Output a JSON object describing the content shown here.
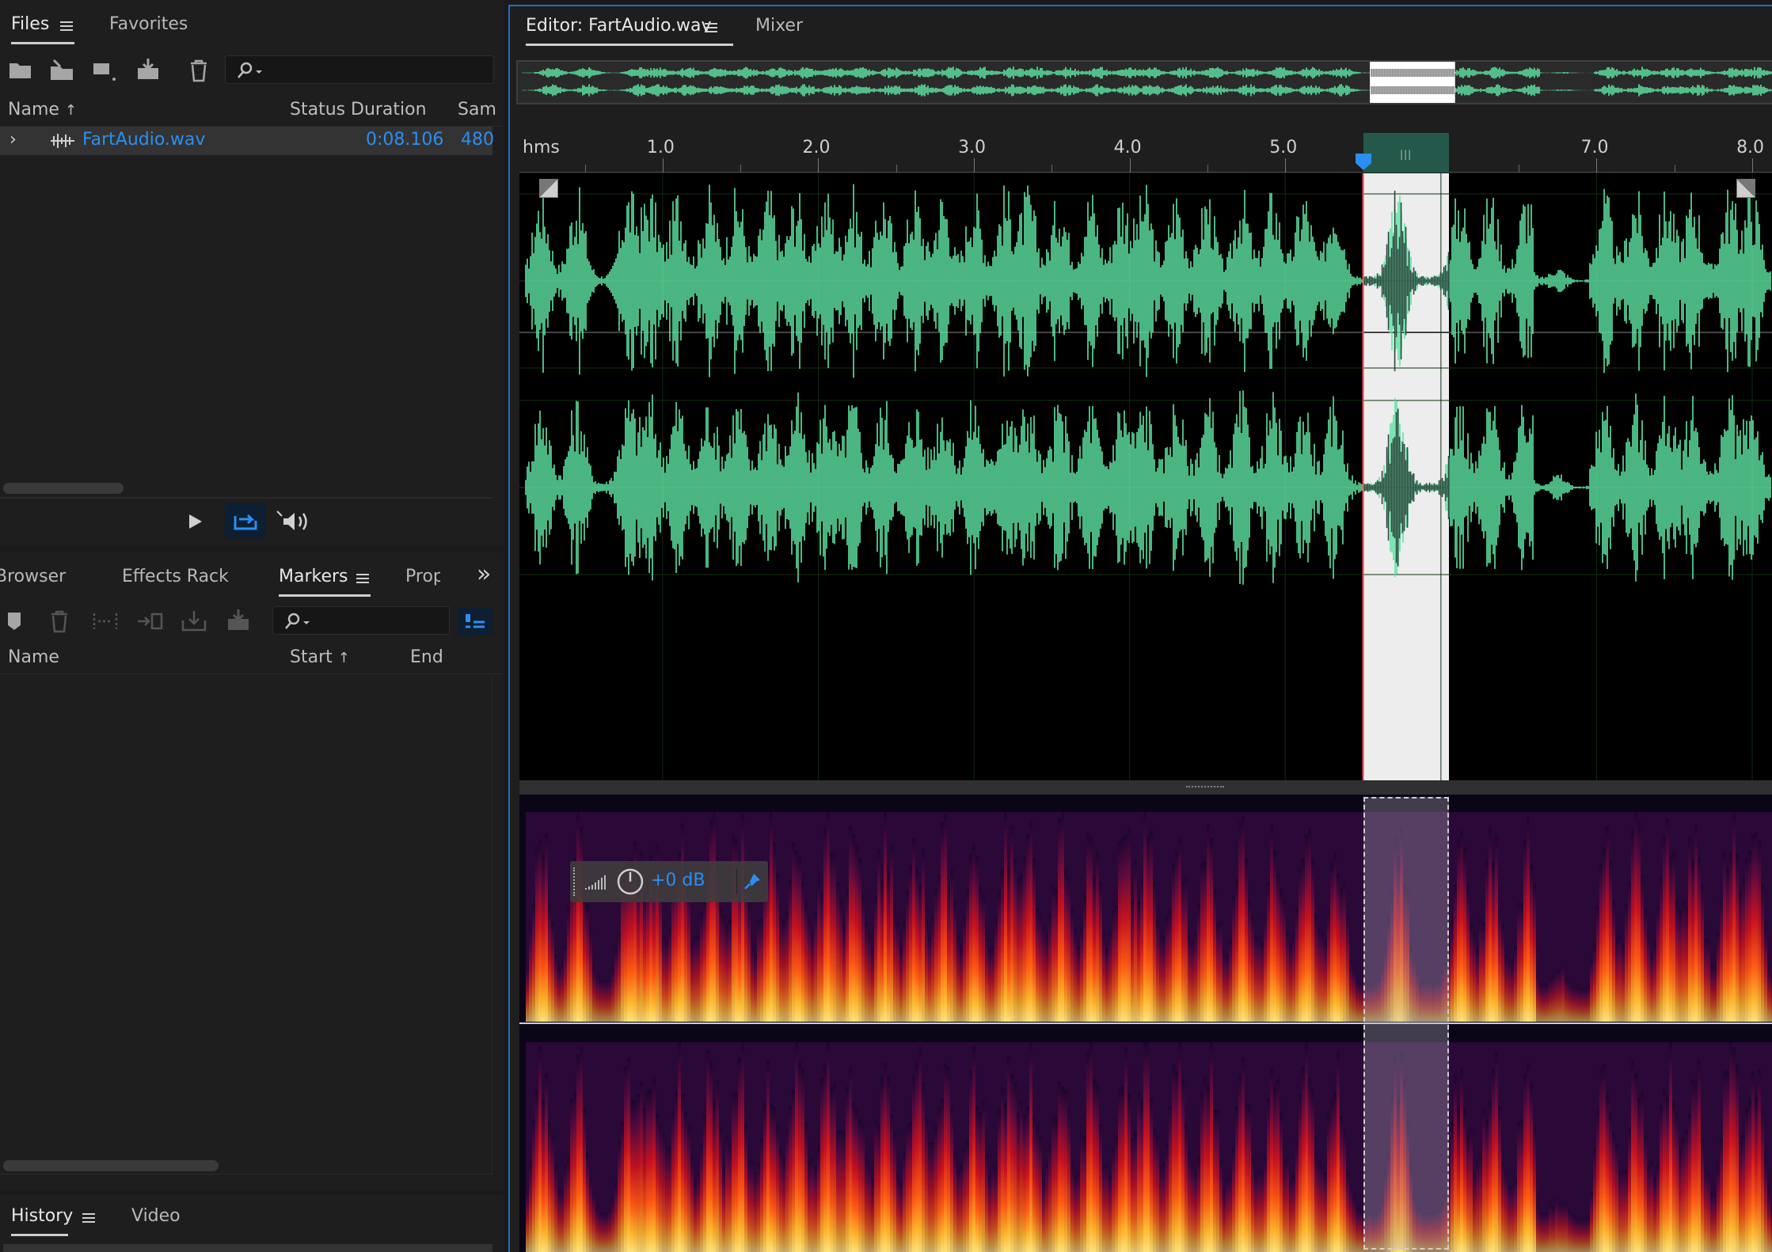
{
  "files_panel": {
    "tabs": [
      "Files",
      "Favorites"
    ],
    "columns": {
      "name": "Name",
      "status": "Status",
      "duration": "Duration",
      "sample": "Sam"
    },
    "row": {
      "name": "FartAudio.wav",
      "duration": "0:08.106",
      "sample": "480"
    }
  },
  "markers_panel": {
    "tabs": [
      "Browser",
      "Effects Rack",
      "Markers",
      "Prop"
    ],
    "overflow": "»",
    "columns": {
      "name": "Name",
      "start": "Start",
      "end": "End"
    }
  },
  "history_panel": {
    "tabs": [
      "History",
      "Video"
    ]
  },
  "editor": {
    "tabs": [
      "Editor: FartAudio.wav",
      "Mixer"
    ],
    "ruler": {
      "unit": "hms",
      "ticks": [
        "1.0",
        "2.0",
        "3.0",
        "4.0",
        "5.0",
        "7.0",
        "8.0"
      ]
    },
    "hud": {
      "gain": "+0 dB"
    },
    "selection": {
      "start_s": 5.5,
      "end_s": 6.05
    },
    "duration_s": 8.106
  },
  "colors": {
    "waveform": "#5ee3a3",
    "selection_bg": "#ededed",
    "selected_wave": "#2b4a3e",
    "accent_blue": "#2b8ff2",
    "playhead": "#ff4a4a"
  },
  "icons": [
    "folder-open-icon",
    "import-icon",
    "new-file-icon",
    "save-icon",
    "trash-icon",
    "search-icon",
    "play-icon",
    "loop-icon",
    "speaker-icon",
    "marker-icon",
    "expand-icon",
    "power-icon",
    "pin-icon"
  ]
}
